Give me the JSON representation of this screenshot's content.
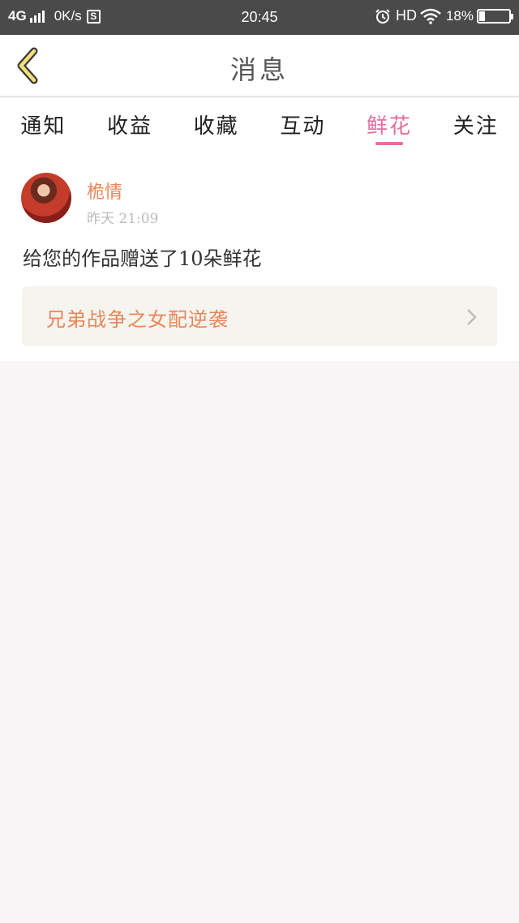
{
  "status_bar": {
    "network": "4G",
    "speed": "0K/s",
    "s_icon_label": "S",
    "time": "20:45",
    "hd": "HD",
    "battery_percent": "18%",
    "battery_level": 0.18
  },
  "header": {
    "title": "消息"
  },
  "tabs": [
    {
      "label": "通知",
      "active": false
    },
    {
      "label": "收益",
      "active": false
    },
    {
      "label": "收藏",
      "active": false
    },
    {
      "label": "互动",
      "active": false
    },
    {
      "label": "鲜花",
      "active": true
    },
    {
      "label": "关注",
      "active": false
    }
  ],
  "notification": {
    "username": "桅情",
    "timestamp": "昨天 21:09",
    "message": "给您的作品赠送了10朵鲜花",
    "work_title": "兄弟战争之女配逆袭"
  },
  "colors": {
    "accent_pink": "#e46f9e",
    "accent_orange": "#e8875a",
    "status_bar_bg": "#4a4a4a"
  }
}
